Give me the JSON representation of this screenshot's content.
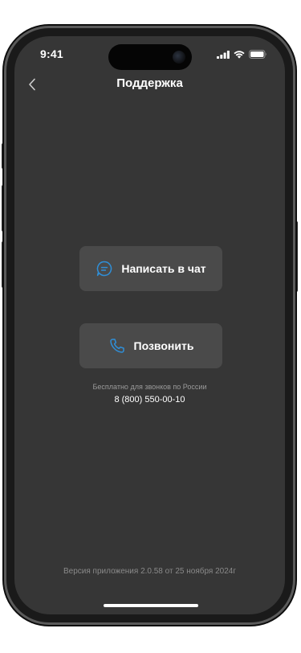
{
  "status_bar": {
    "time": "9:41"
  },
  "nav": {
    "back_icon": "chevron-left-icon",
    "title": "Поддержка"
  },
  "actions": {
    "chat": {
      "icon": "chat-bubble-icon",
      "label": "Написать в чат"
    },
    "call": {
      "icon": "phone-icon",
      "label": "Позвонить"
    }
  },
  "phone_info": {
    "hint": "Бесплатно для звонков по России",
    "number": "8 (800) 550-00-10"
  },
  "footer": {
    "version": "Версия приложения 2.0.58 от 25 ноября 2024г"
  },
  "colors": {
    "screen_background": "#363636",
    "button_background": "#4a4a4a",
    "accent_icon": "#2f8fd8",
    "text_primary": "#ffffff",
    "text_secondary": "#9a9a9a"
  }
}
